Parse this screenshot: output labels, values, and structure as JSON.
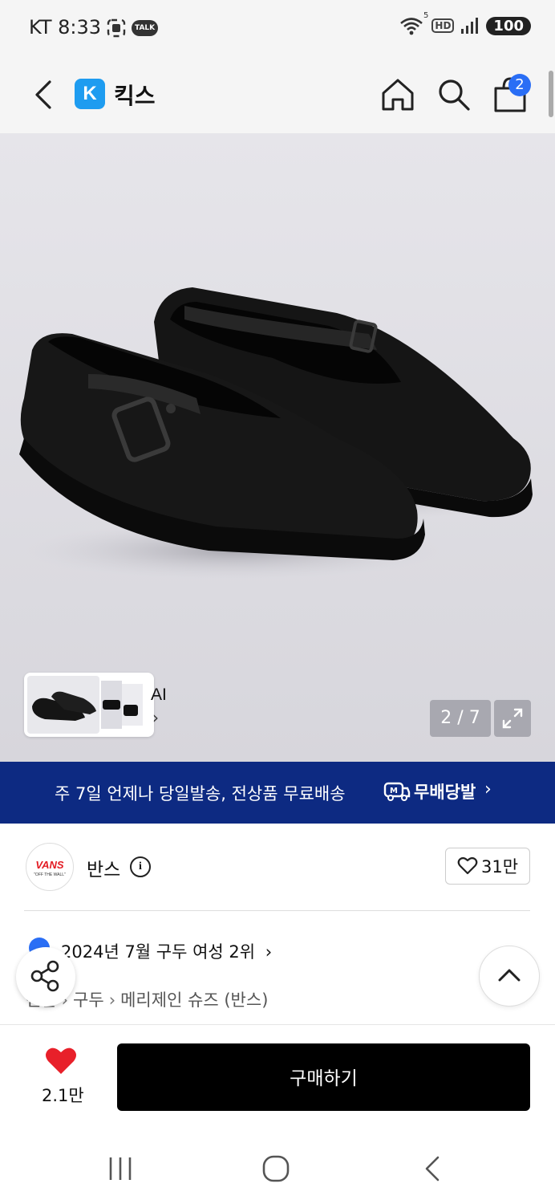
{
  "status_bar": {
    "carrier_time": "KT 8:33",
    "talk_label": "TALK",
    "net_badge": "HD",
    "wifi_badge": "5",
    "battery": "100"
  },
  "header": {
    "logo_letter": "K",
    "app_title": "킥스",
    "cart_count": "2",
    "accent_color": "#1e9cf0",
    "badge_color": "#2a6ef5"
  },
  "gallery": {
    "ai_label": "AI",
    "page_counter": "2 / 7"
  },
  "promo": {
    "text": "주 7일 언제나 당일발송, 전상품 무료배송",
    "logo_text": "무배당발",
    "background_color": "#0d2a82"
  },
  "brand": {
    "logo_text": "VANS",
    "logo_sub": "\"OFF THE WALL\"",
    "name": "반스",
    "like_count": "31만"
  },
  "rank": {
    "text": "2024년 7월 구두 여성 2위"
  },
  "breadcrumb": {
    "items": [
      "신발",
      "구두",
      "메리제인 슈즈 (반스)"
    ]
  },
  "action_bar": {
    "heart_count": "2.1만",
    "buy_label": "구매하기",
    "heart_color": "#e8202a"
  }
}
